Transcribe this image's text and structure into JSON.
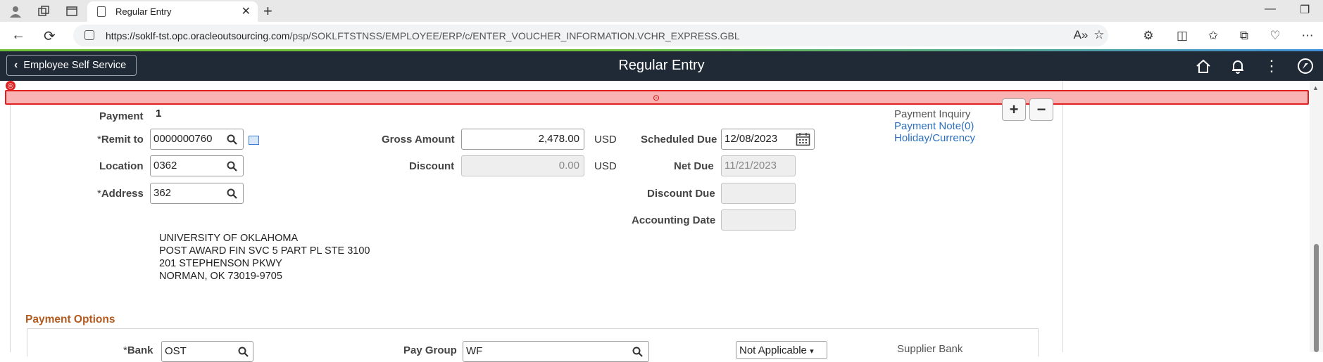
{
  "browser": {
    "tab_title": "Regular Entry",
    "url_host": "https://soklf-tst.opc.oracleoutsourcing.com",
    "url_path": "/psp/SOKLFTSTNSS/EMPLOYEE/ERP/c/ENTER_VOUCHER_INFORMATION.VCHR_EXPRESS.GBL"
  },
  "header": {
    "back_label": "Employee Self Service",
    "title": "Regular Entry"
  },
  "payment": {
    "label": "Payment",
    "number": "1",
    "remit_to_label": "Remit to",
    "remit_to_value": "0000000760",
    "location_label": "Location",
    "location_value": "0362",
    "address_label": "Address",
    "address_value": "362",
    "gross_amount_label": "Gross Amount",
    "gross_amount_value": "2,478.00",
    "gross_currency": "USD",
    "discount_label": "Discount",
    "discount_value": "0.00",
    "discount_currency": "USD",
    "scheduled_due_label": "Scheduled Due",
    "scheduled_due_value": "12/08/2023",
    "net_due_label": "Net Due",
    "net_due_value": "11/21/2023",
    "discount_due_label": "Discount Due",
    "discount_due_value": "",
    "accounting_date_label": "Accounting Date",
    "accounting_date_value": "",
    "payment_inquiry": "Payment Inquiry",
    "payment_note": "Payment Note(0)",
    "holiday_currency": "Holiday/Currency",
    "address_lines": [
      "UNIVERSITY OF OKLAHOMA",
      "POST AWARD FIN SVC 5 PART PL STE 3100",
      "201 STEPHENSON PKWY",
      "NORMAN, OK  73019-9705"
    ]
  },
  "payment_options": {
    "title": "Payment Options",
    "bank_label": "Bank",
    "bank_value": "OST",
    "pay_group_label": "Pay Group",
    "pay_group_value": "WF",
    "handling_value": "Not Applicable",
    "supplier_bank": "Supplier Bank"
  },
  "required_marker": "*",
  "colors": {
    "header_bg": "#1f2a36",
    "link": "#2c6fbf",
    "section_title": "#b35a1f",
    "error_bar": "#f9b3b3"
  }
}
